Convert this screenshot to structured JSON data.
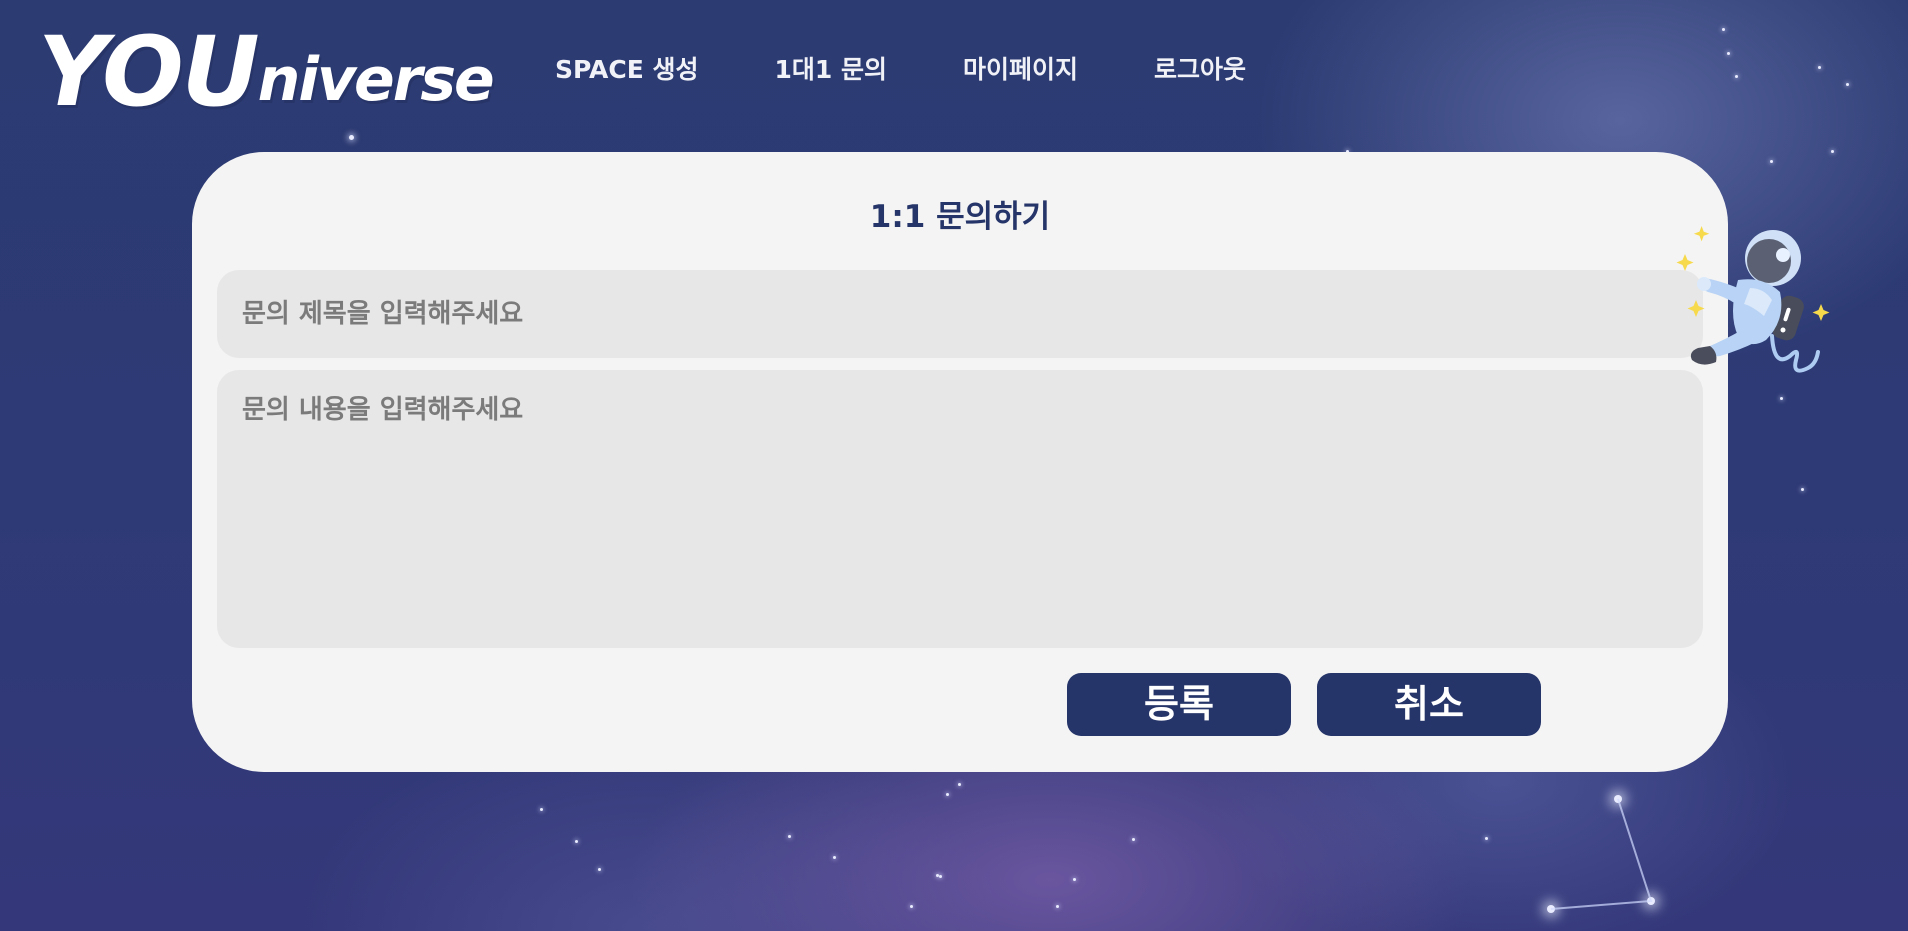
{
  "header": {
    "logo_you": "YOU",
    "logo_rest": "niverse",
    "nav": [
      {
        "label": "SPACE 생성"
      },
      {
        "label": "1대1 문의"
      },
      {
        "label": "마이페이지"
      },
      {
        "label": "로그아웃"
      }
    ]
  },
  "form": {
    "title": "1:1 문의하기",
    "subject_placeholder": "문의 제목을 입력해주세요",
    "subject_value": "",
    "content_placeholder": "문의 내용을 입력해주세요",
    "content_value": "",
    "submit_label": "등록",
    "cancel_label": "취소"
  },
  "colors": {
    "primary": "#253469",
    "card_background": "#f4f4f4",
    "field_background": "#e7e7e7",
    "placeholder": "#7b7b7b",
    "star_accent": "#f7d94c"
  },
  "icons": {
    "decoration": "astronaut-illustration"
  }
}
